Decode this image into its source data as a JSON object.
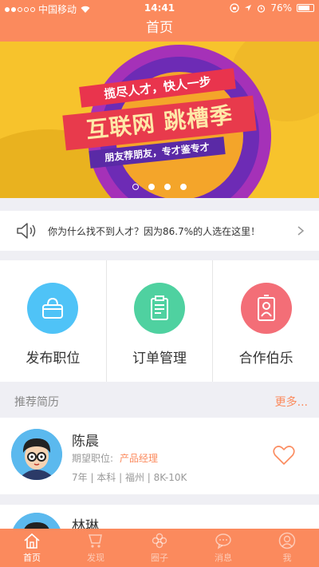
{
  "status": {
    "carrier": "中国移动",
    "time": "14:41",
    "battery": "76%",
    "battery_level": 0.76
  },
  "nav": {
    "title": "首页"
  },
  "banner": {
    "line1": "揽尽人才，快人一步",
    "line2": "互联网 跳槽季",
    "line3": "朋友荐朋友，专才鉴专才",
    "pages": 4,
    "active_page": 0
  },
  "notice": {
    "text": "你为什么找不到人才？因为86.7%的人选在这里！",
    "icon": "speaker-icon"
  },
  "actions": [
    {
      "label": "发布职位",
      "icon": "bag-icon",
      "color": "#4fc3f7"
    },
    {
      "label": "订单管理",
      "icon": "clipboard-icon",
      "color": "#4fd1a0"
    },
    {
      "label": "合作伯乐",
      "icon": "badge-icon",
      "color": "#f36e77"
    }
  ],
  "resumes_section": {
    "title": "推荐简历",
    "more": "更多..."
  },
  "resumes": [
    {
      "name": "陈晨",
      "desired_label": "期望职位:",
      "desired_value": "产品经理",
      "meta": "7年 | 本科 | 福州 | 8K-10K"
    },
    {
      "name": "林琳"
    }
  ],
  "tabs": [
    {
      "label": "首页",
      "icon": "home-icon",
      "active": true
    },
    {
      "label": "发现",
      "icon": "discover-icon",
      "active": false
    },
    {
      "label": "圈子",
      "icon": "flower-icon",
      "active": false
    },
    {
      "label": "消息",
      "icon": "message-icon",
      "active": false
    },
    {
      "label": "我",
      "icon": "profile-icon",
      "active": false
    }
  ],
  "colors": {
    "primary": "#fb8a5d",
    "banner_bg": "#f7c32c"
  }
}
